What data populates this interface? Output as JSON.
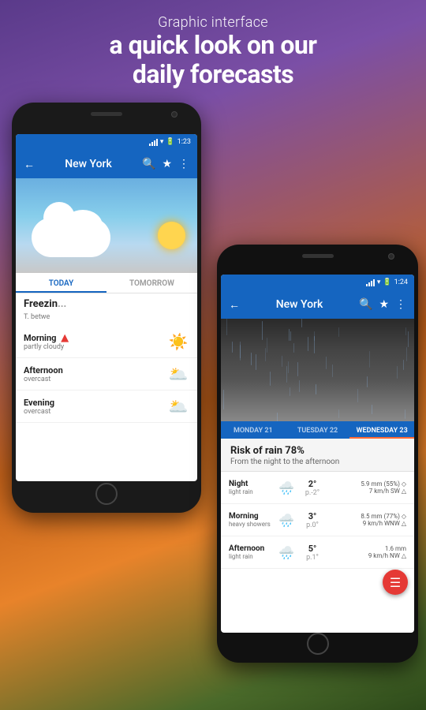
{
  "header": {
    "subtitle": "Graphic interface",
    "title_line1": "a quick look on our",
    "title_line2": "daily forecasts"
  },
  "phone_left": {
    "status_bar": {
      "time": "1:23"
    },
    "toolbar": {
      "title": "New York",
      "back_icon": "←",
      "search_icon": "🔍",
      "star_icon": "★",
      "more_icon": "⋮"
    },
    "tabs": [
      {
        "label": "TODAY",
        "active": true
      },
      {
        "label": "TOMORROW",
        "active": false
      }
    ],
    "freezing": {
      "title": "Freezin",
      "subtitle": "T. betwe"
    },
    "forecast_rows": [
      {
        "period": "Morning",
        "condition": "partly cloudy",
        "has_alert": true,
        "icon": "☀️"
      },
      {
        "period": "Afternoon",
        "condition": "overcast",
        "has_alert": false,
        "icon": "🌥️"
      },
      {
        "period": "Evening",
        "condition": "overcast",
        "has_alert": false,
        "icon": "🌥️"
      }
    ]
  },
  "phone_right": {
    "status_bar": {
      "time": "1:24"
    },
    "toolbar": {
      "title": "New York",
      "back_icon": "←",
      "search_icon": "🔍",
      "star_icon": "★",
      "more_icon": "⋮"
    },
    "day_tabs": [
      {
        "label": "MONDAY 21",
        "active": false
      },
      {
        "label": "TUESDAY 22",
        "active": false
      },
      {
        "label": "WEDNESDAY 23",
        "active": true
      }
    ],
    "rain_info": {
      "title": "Risk of rain 78%",
      "subtitle": "From the night to the afternoon"
    },
    "forecast_rows": [
      {
        "period": "Night",
        "condition": "light rain",
        "icon": "🌧️",
        "temp_hi": "2°",
        "temp_lo": "p.-2°",
        "detail1": "5.9 mm (55%) ◇",
        "detail2": "7 km/h SW △"
      },
      {
        "period": "Morning",
        "condition": "heavy showers",
        "icon": "🌧️",
        "temp_hi": "3°",
        "temp_lo": "p.0°",
        "detail1": "8.5 mm (77%) ◇",
        "detail2": "9 km/h WNW △"
      },
      {
        "period": "Afternoon",
        "condition": "light rain",
        "icon": "🌧️",
        "temp_hi": "5°",
        "temp_lo": "p.1°",
        "detail1": "1.6 mm",
        "detail2": "9 km/h NW △"
      }
    ],
    "fab_icon": "☰"
  }
}
